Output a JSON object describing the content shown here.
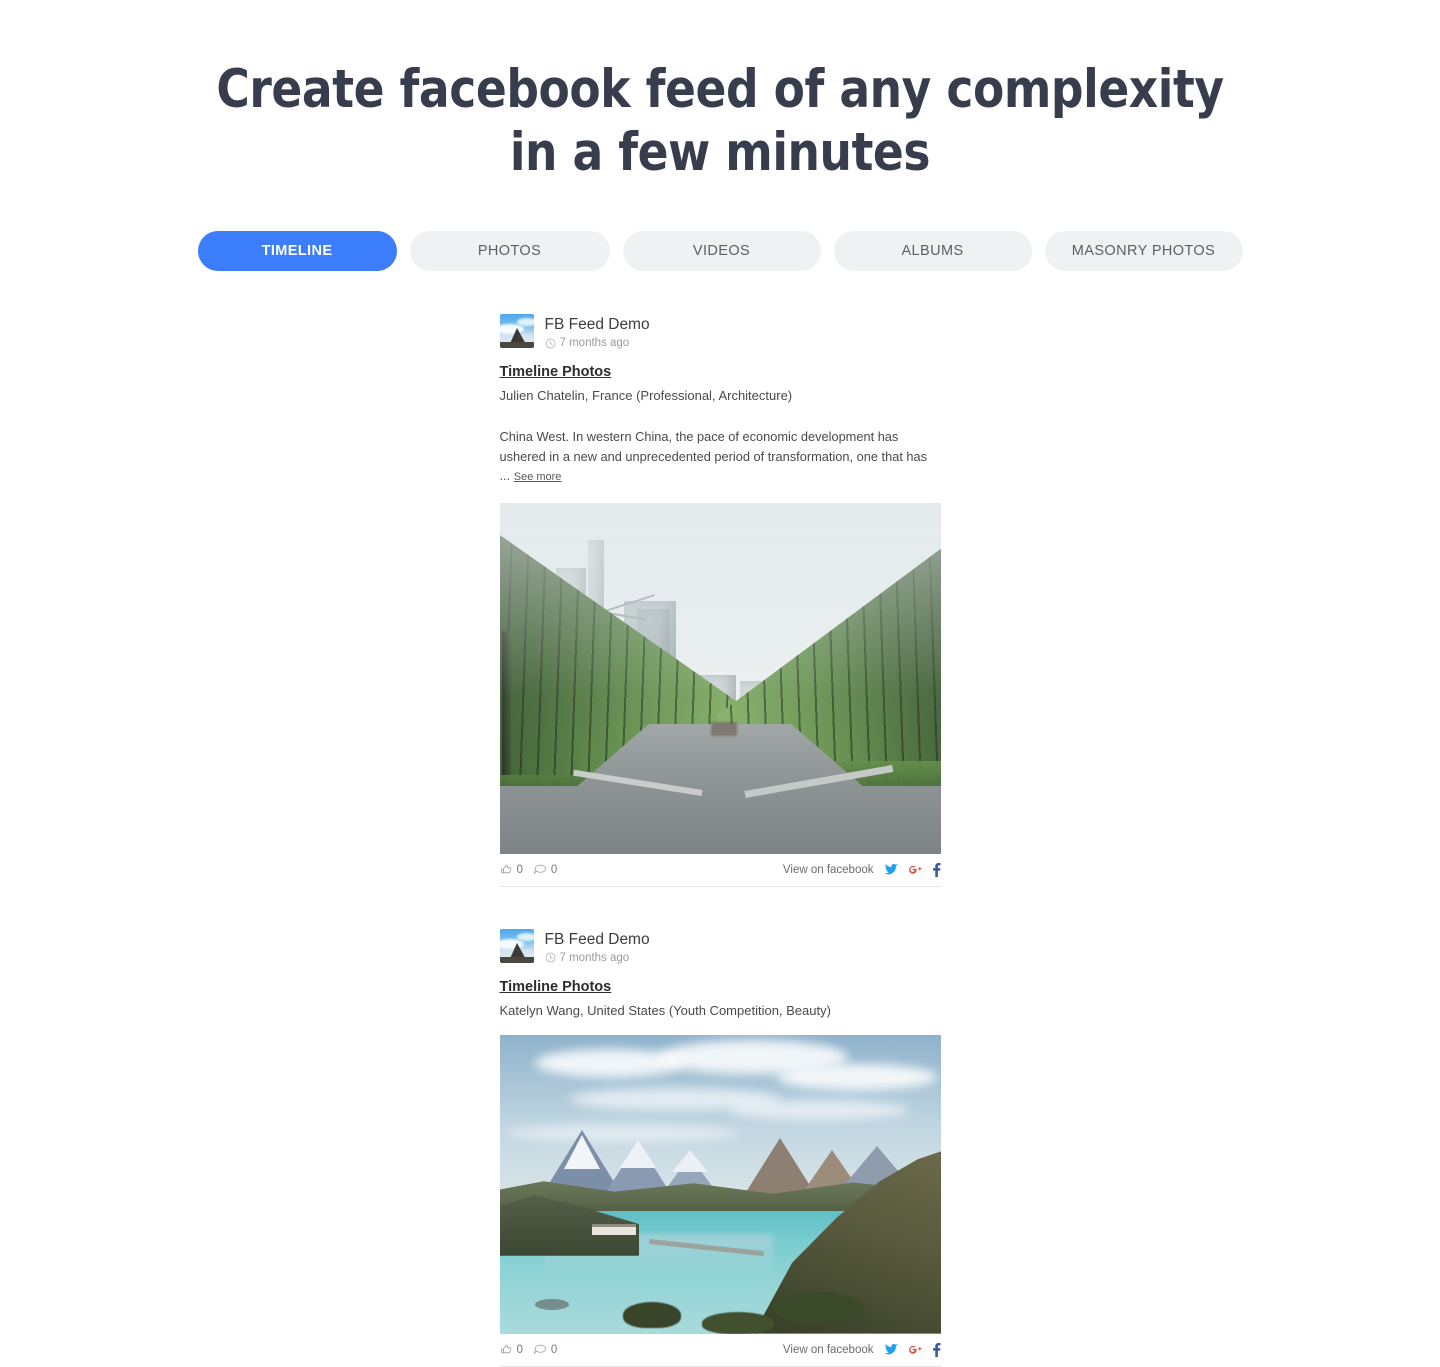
{
  "headline": {
    "line1": "Create facebook feed of any complexity",
    "line2": "in a few minutes"
  },
  "tabs": [
    {
      "label": "TIMELINE",
      "active": true
    },
    {
      "label": "PHOTOS",
      "active": false
    },
    {
      "label": "VIDEOS",
      "active": false
    },
    {
      "label": "ALBUMS",
      "active": false
    },
    {
      "label": "MASONRY PHOTOS",
      "active": false
    }
  ],
  "colors": {
    "active_tab_bg": "#3b7dfb",
    "inactive_tab_bg": "#f0f1f2",
    "headline": "#373d4c",
    "twitter": "#1da1f2",
    "googleplus": "#dd4b39",
    "facebook": "#3b5998"
  },
  "posts": [
    {
      "author": "FB Feed Demo",
      "timestamp": "7 months ago",
      "title": "Timeline Photos",
      "subtitle": "Julien Chatelin, France (Professional, Architecture)",
      "body": "China West. In western China, the pace of economic development has ushered in a new and unprecedented period of transformation, one that has ...",
      "see_more": "See more",
      "likes": "0",
      "comments": "0",
      "view_label": "View on facebook",
      "image_alt": "Hazy city street lined with green printed barrier walls, high-rise towers in the distance"
    },
    {
      "author": "FB Feed Demo",
      "timestamp": "7 months ago",
      "title": "Timeline Photos",
      "subtitle": "Katelyn Wang, United States (Youth Competition, Beauty)",
      "body": "",
      "see_more": "",
      "likes": "0",
      "comments": "0",
      "view_label": "View on facebook",
      "image_alt": "Turquoise glacial lake with snow-capped Patagonian mountains and a footbridge"
    }
  ],
  "icons": {
    "clock": "clock-icon",
    "like": "like-icon",
    "comment": "comment-icon",
    "twitter": "twitter-icon",
    "googleplus": "google-plus-icon",
    "facebook": "facebook-icon"
  }
}
